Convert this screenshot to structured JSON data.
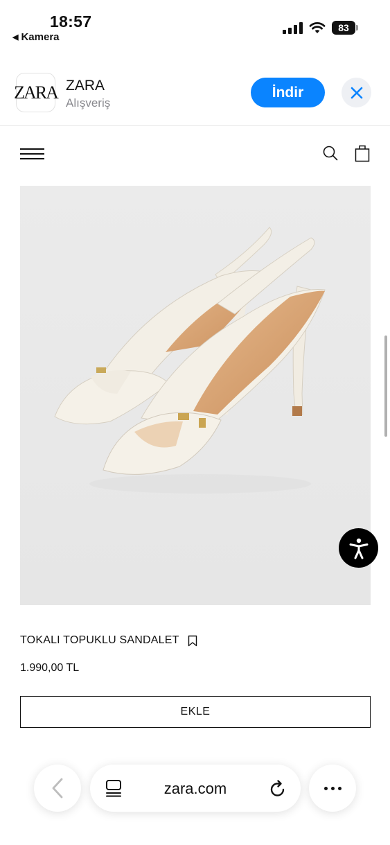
{
  "status_bar": {
    "time": "18:57",
    "back_label": "Kamera",
    "battery": "83"
  },
  "app_banner": {
    "icon_text": "ZARA",
    "app_name": "ZARA",
    "category": "Alışveriş",
    "download_label": "İndir"
  },
  "header": {
    "menu_icon": "hamburger-menu-icon",
    "search_icon": "search-icon",
    "bag_icon": "shopping-bag-icon"
  },
  "product": {
    "image_alt": "shoe-product-image",
    "name": "TOKALI TOPUKLU SANDALET",
    "price": "1.990,00 TL",
    "add_label": "EKLE"
  },
  "browser": {
    "url": "zara.com"
  },
  "colors": {
    "accent": "#0a84ff",
    "image_bg": "#eaeaea"
  }
}
